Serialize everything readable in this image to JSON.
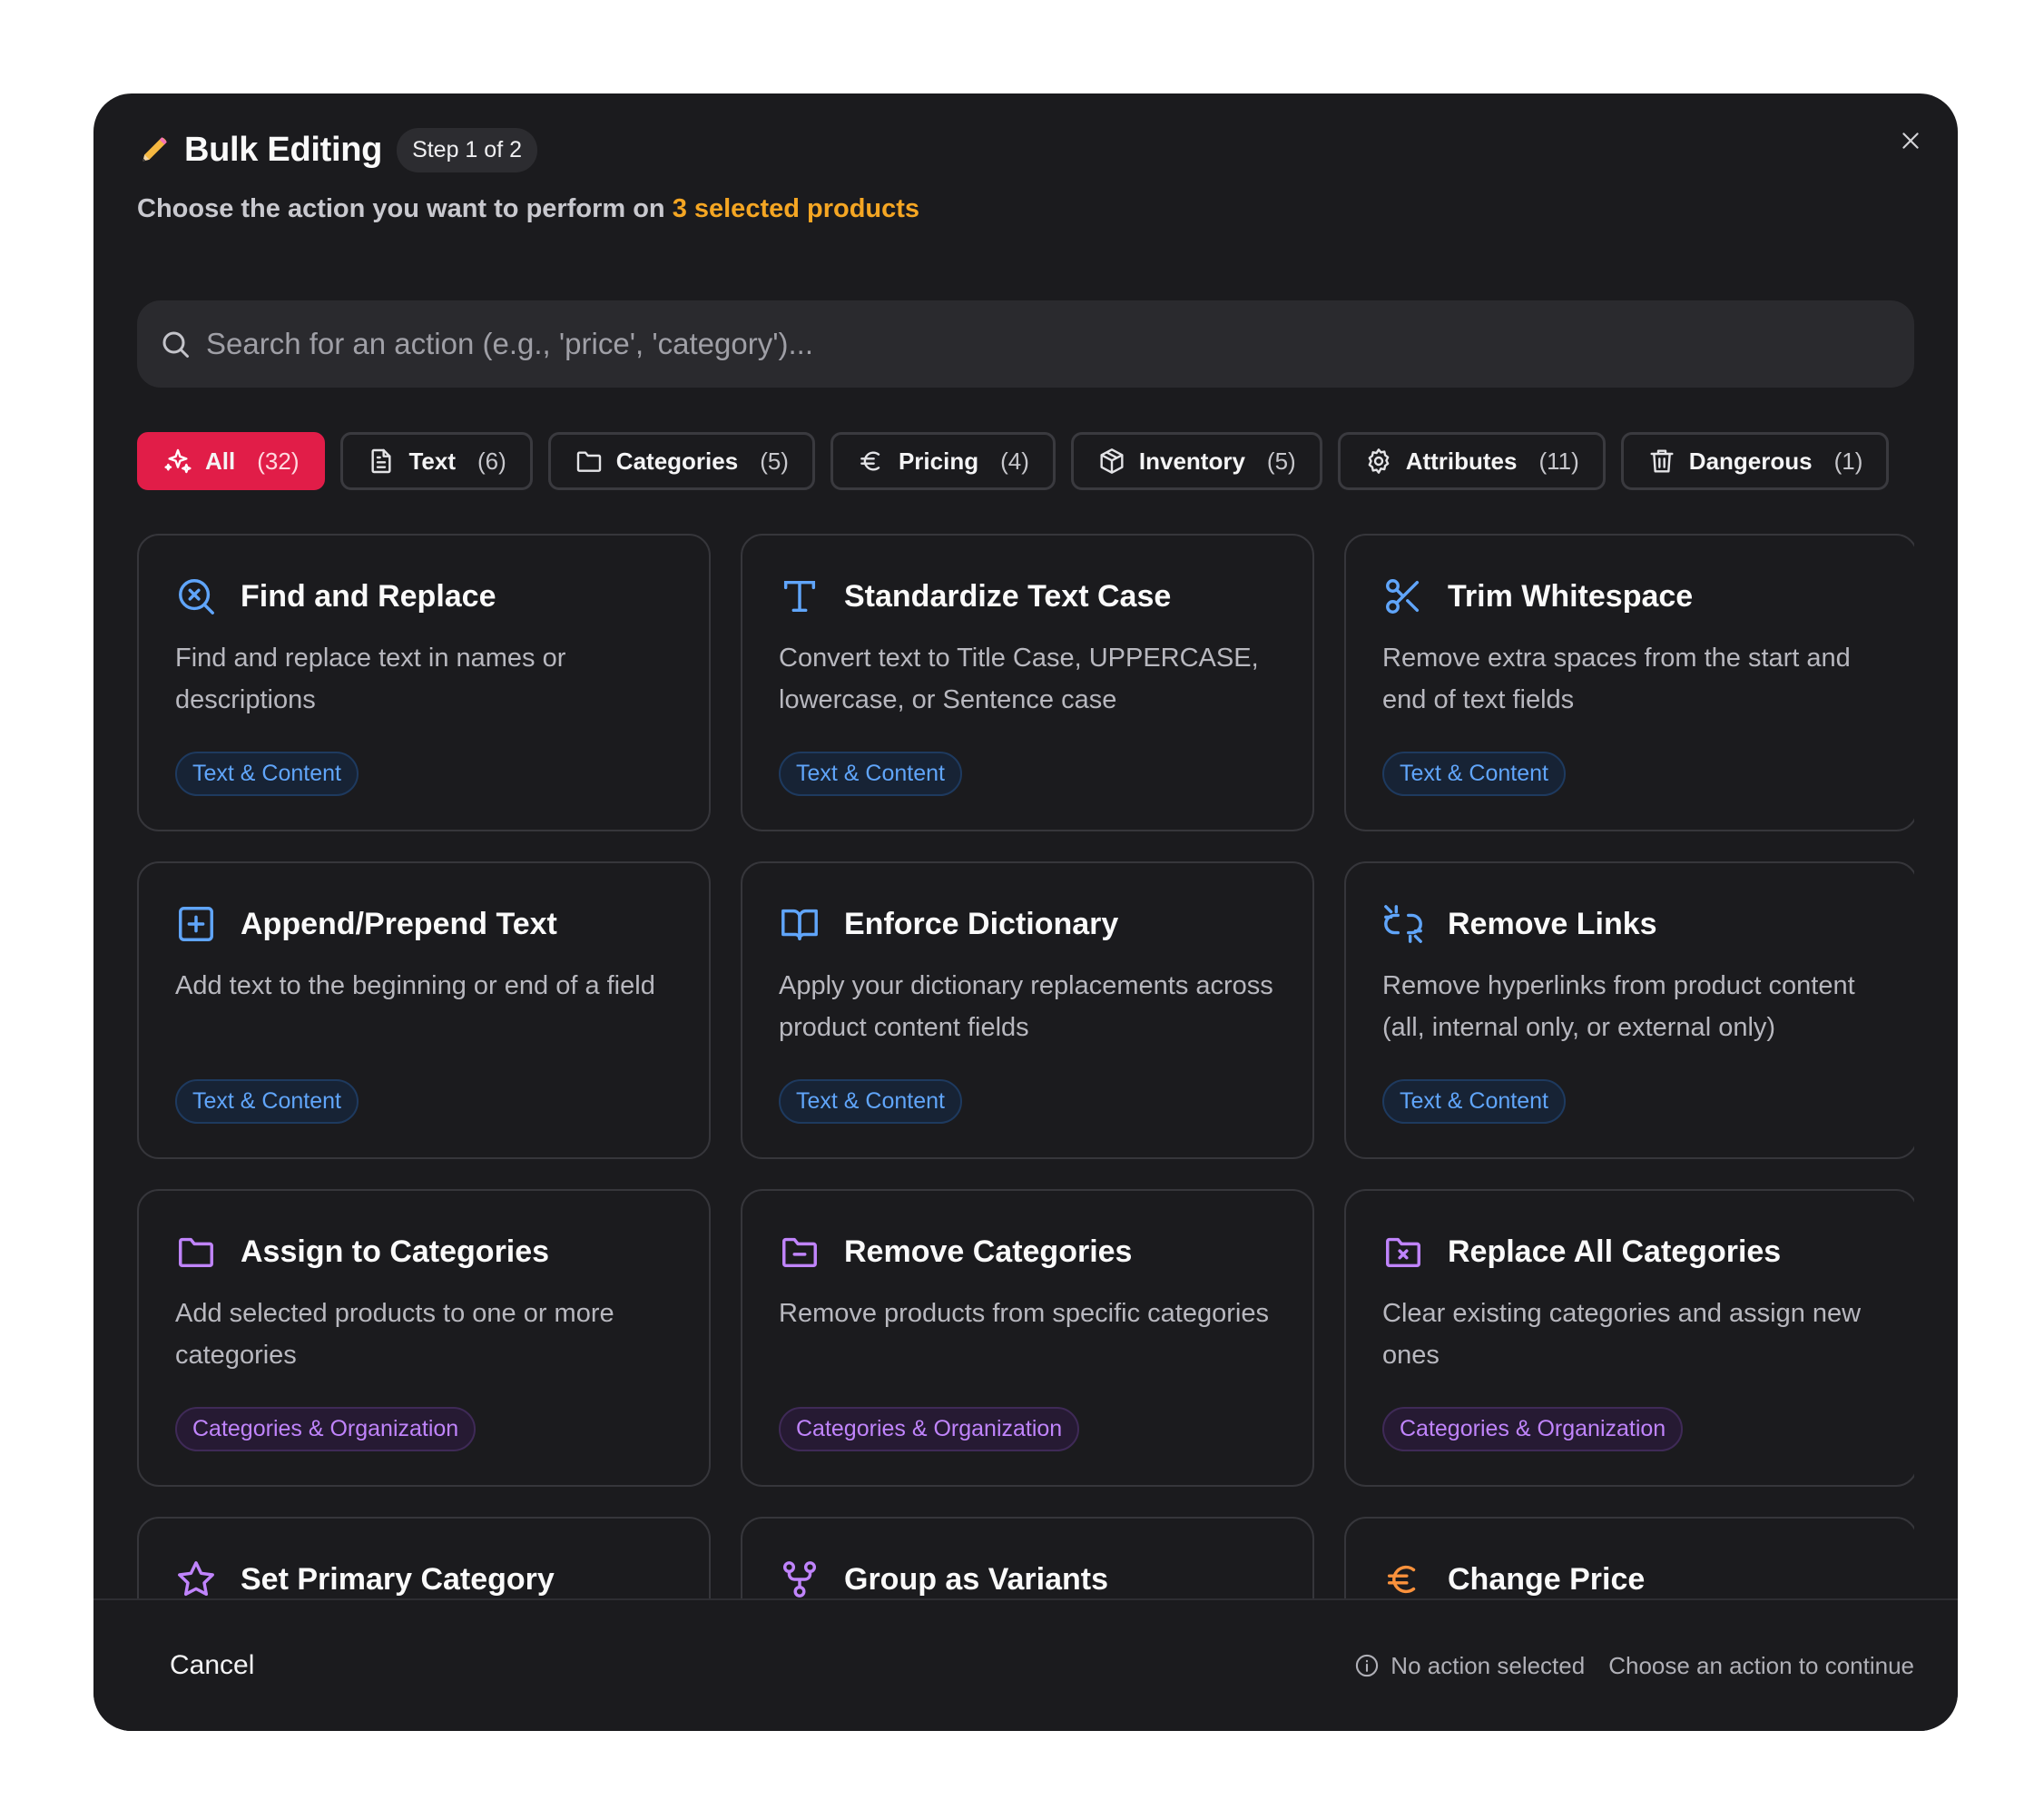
{
  "dialog": {
    "title": "Bulk Editing",
    "step": "Step 1 of 2",
    "subtitle_prefix": "Choose the action you want to perform on ",
    "subtitle_highlight": "3 selected products"
  },
  "search": {
    "placeholder": "Search for an action (e.g., 'price', 'category')..."
  },
  "filters": [
    {
      "label": "All",
      "count": "(32)",
      "icon": "sparkles-icon",
      "active": true
    },
    {
      "label": "Text",
      "count": "(6)",
      "icon": "document-icon"
    },
    {
      "label": "Categories",
      "count": "(5)",
      "icon": "folder-icon"
    },
    {
      "label": "Pricing",
      "count": "(4)",
      "icon": "euro-icon"
    },
    {
      "label": "Inventory",
      "count": "(5)",
      "icon": "box-icon"
    },
    {
      "label": "Attributes",
      "count": "(11)",
      "icon": "gear-icon"
    },
    {
      "label": "Dangerous",
      "count": "(1)",
      "icon": "trash-icon"
    }
  ],
  "actions": [
    {
      "title": "Find and Replace",
      "description": "Find and replace text in names or descriptions",
      "tag": "Text & Content",
      "icon": "search-x-icon"
    },
    {
      "title": "Standardize Text Case",
      "description": "Convert text to Title Case, UPPERCASE, lowercase, or Sentence case",
      "tag": "Text & Content",
      "icon": "type-icon"
    },
    {
      "title": "Trim Whitespace",
      "description": "Remove extra spaces from the start and end of text fields",
      "tag": "Text & Content",
      "icon": "scissors-icon"
    },
    {
      "title": "Append/Prepend Text",
      "description": "Add text to the beginning or end of a field",
      "tag": "Text & Content",
      "icon": "plus-square-icon"
    },
    {
      "title": "Enforce Dictionary",
      "description": "Apply your dictionary replacements across product content fields",
      "tag": "Text & Content",
      "icon": "book-icon"
    },
    {
      "title": "Remove Links",
      "description": "Remove hyperlinks from product content (all, internal only, or external only)",
      "tag": "Text & Content",
      "icon": "unlink-icon"
    },
    {
      "title": "Assign to Categories",
      "description": "Add selected products to one or more categories",
      "tag": "Categories & Organization",
      "icon": "folder-icon"
    },
    {
      "title": "Remove Categories",
      "description": "Remove products from specific categories",
      "tag": "Categories & Organization",
      "icon": "folder-minus-icon"
    },
    {
      "title": "Replace All Categories",
      "description": "Clear existing categories and assign new ones",
      "tag": "Categories & Organization",
      "icon": "folder-x-icon"
    },
    {
      "title": "Set Primary Category",
      "description": "",
      "tag": "",
      "icon": "star-icon"
    },
    {
      "title": "Group as Variants",
      "description": "",
      "tag": "",
      "icon": "git-fork-icon"
    },
    {
      "title": "Change Price",
      "description": "",
      "tag": "",
      "icon": "euro-icon"
    }
  ],
  "footer": {
    "cancel": "Cancel",
    "status": "No action selected",
    "hint": "Choose an action to continue"
  },
  "colors": {
    "accent_active": "#e11d48",
    "highlight": "#f5a623",
    "text_tag": "#60a5fa",
    "category_tag": "#c084fc",
    "pricing": "#fb923c"
  }
}
